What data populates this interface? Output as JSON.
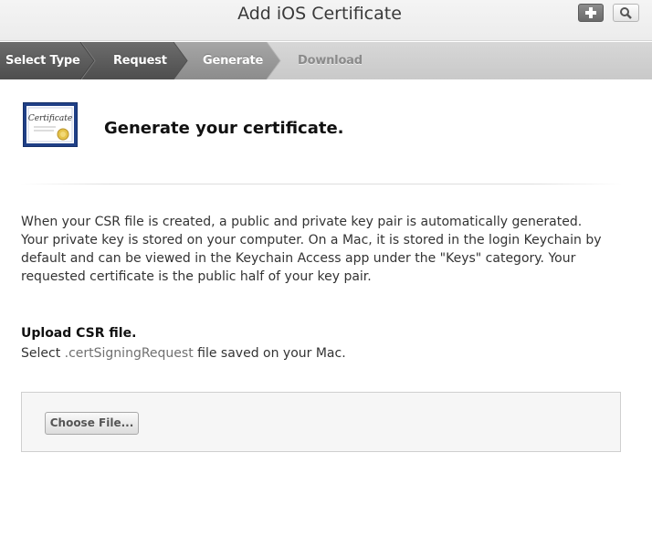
{
  "window": {
    "title": "Add iOS Certificate"
  },
  "toolbar": {
    "add_icon": "plus-icon",
    "search_icon": "search-icon"
  },
  "steps": [
    {
      "label": "Select Type",
      "state": "done"
    },
    {
      "label": "Request",
      "state": "done"
    },
    {
      "label": "Generate",
      "state": "current"
    },
    {
      "label": "Download",
      "state": "pending"
    }
  ],
  "header": {
    "icon": "certificate-icon",
    "icon_text": "Certificate",
    "title": "Generate your certificate."
  },
  "description": "When your CSR file is created, a public and private key pair is automatically generated. Your private key is stored on your computer. On a Mac, it is stored in the login Keychain by default and can be viewed in the Keychain Access app under the \"Keys\" category. Your requested certificate is the public half of your key pair.",
  "upload": {
    "title": "Upload CSR file.",
    "sub_prefix": "Select ",
    "sub_ext": ".certSigningRequest",
    "sub_suffix": " file saved on your Mac.",
    "button_label": "Choose File..."
  },
  "colors": {
    "step_done": "#5e5e5e",
    "step_current": "#9a9a9a",
    "step_pending": "#cdcdcd"
  }
}
